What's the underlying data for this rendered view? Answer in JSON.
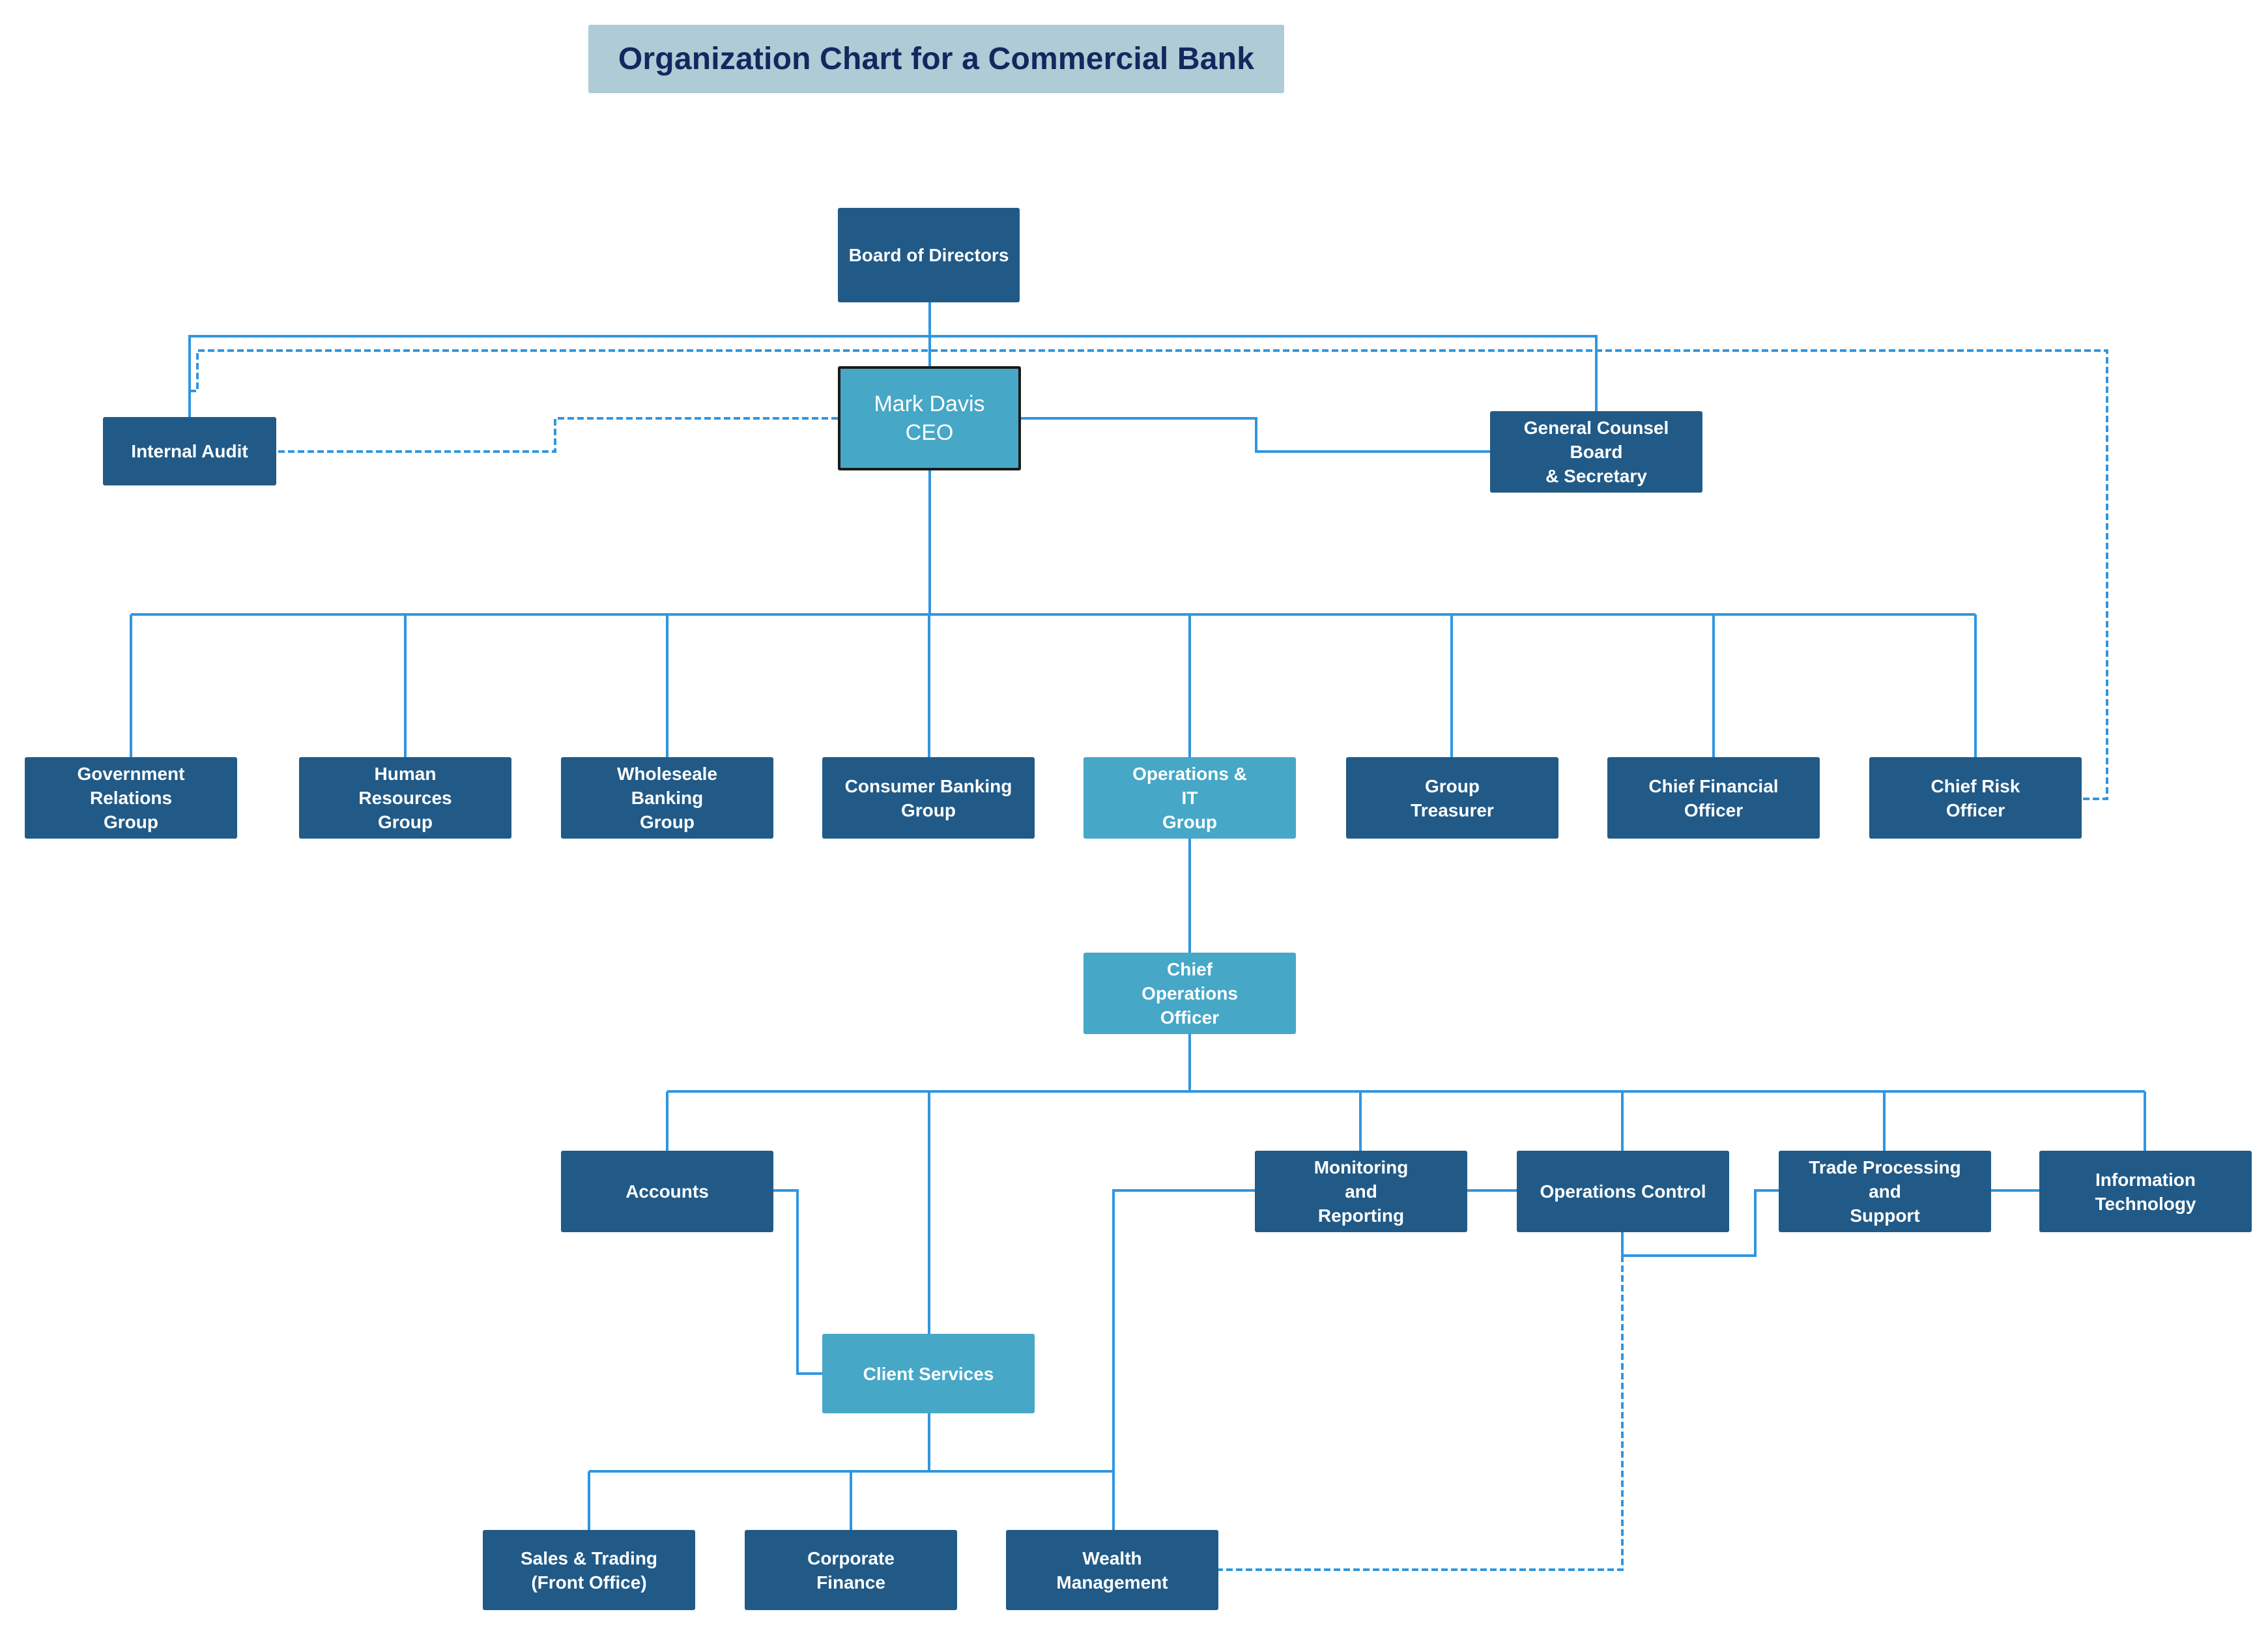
{
  "title": "Organization Chart for a Commercial Bank",
  "colors": {
    "node_dark": "#215a87",
    "node_light": "#46a7c7",
    "connector": "#3096e0",
    "title_bg": "#aecbd6",
    "title_text": "#12285e",
    "ceo_border": "#1a1a1a"
  },
  "nodes": {
    "board": "Board of Directors",
    "ceo": "Mark Davis\nCEO",
    "internal_audit": "Internal Audit",
    "general_counsel": "General Counsel Board\n& Secretary",
    "gov_relations": "Government\nRelations\nGroup",
    "human_resources": "Human\nResources\nGroup",
    "wholesale_banking": "Wholeseale\nBanking\nGroup",
    "consumer_banking": "Consumer Banking\nGroup",
    "operations_it": "Operations &\nIT\nGroup",
    "group_treasurer": "Group\nTreasurer",
    "cfo": "Chief Financial\nOfficer",
    "cro": "Chief Risk\nOfficer",
    "coo": "Chief\nOperations\nOfficer",
    "accounts": "Accounts",
    "monitoring_reporting": "Monitoring\nand\nReporting",
    "operations_control": "Operations Control",
    "trade_processing": "Trade Processing\nand\nSupport",
    "information_technology": "Information\nTechnology",
    "client_services": "Client Services",
    "sales_trading": "Sales & Trading\n(Front Office)",
    "corporate_finance": "Corporate\nFinance",
    "wealth_management": "Wealth\nManagement"
  },
  "relationships": [
    {
      "from": "board",
      "to": "ceo",
      "style": "solid"
    },
    {
      "from": "board",
      "to": "internal_audit",
      "style": "solid"
    },
    {
      "from": "board",
      "to": "general_counsel",
      "style": "solid"
    },
    {
      "from": "ceo",
      "to": "internal_audit",
      "style": "dashed"
    },
    {
      "from": "ceo",
      "to": "general_counsel",
      "style": "solid"
    },
    {
      "from": "internal_audit",
      "to": "cro",
      "style": "dashed"
    },
    {
      "from": "ceo",
      "to": "gov_relations",
      "style": "solid"
    },
    {
      "from": "ceo",
      "to": "human_resources",
      "style": "solid"
    },
    {
      "from": "ceo",
      "to": "wholesale_banking",
      "style": "solid"
    },
    {
      "from": "ceo",
      "to": "consumer_banking",
      "style": "solid"
    },
    {
      "from": "ceo",
      "to": "operations_it",
      "style": "solid"
    },
    {
      "from": "ceo",
      "to": "group_treasurer",
      "style": "solid"
    },
    {
      "from": "ceo",
      "to": "cfo",
      "style": "solid"
    },
    {
      "from": "ceo",
      "to": "cro",
      "style": "solid"
    },
    {
      "from": "operations_it",
      "to": "coo",
      "style": "solid"
    },
    {
      "from": "coo",
      "to": "accounts",
      "style": "solid"
    },
    {
      "from": "coo",
      "to": "client_services",
      "style": "solid"
    },
    {
      "from": "coo",
      "to": "monitoring_reporting",
      "style": "solid"
    },
    {
      "from": "coo",
      "to": "operations_control",
      "style": "solid"
    },
    {
      "from": "coo",
      "to": "trade_processing",
      "style": "solid"
    },
    {
      "from": "coo",
      "to": "information_technology",
      "style": "solid"
    },
    {
      "from": "accounts",
      "to": "client_services",
      "style": "solid"
    },
    {
      "from": "monitoring_reporting",
      "to": "operations_control",
      "style": "solid"
    },
    {
      "from": "monitoring_reporting",
      "to": "wealth_management",
      "style": "solid"
    },
    {
      "from": "operations_control",
      "to": "trade_processing",
      "style": "solid"
    },
    {
      "from": "trade_processing",
      "to": "information_technology",
      "style": "solid"
    },
    {
      "from": "client_services",
      "to": "sales_trading",
      "style": "solid"
    },
    {
      "from": "client_services",
      "to": "corporate_finance",
      "style": "solid"
    },
    {
      "from": "client_services",
      "to": "wealth_management",
      "style": "solid"
    },
    {
      "from": "operations_control",
      "to": "wealth_management",
      "style": "dashed"
    }
  ]
}
